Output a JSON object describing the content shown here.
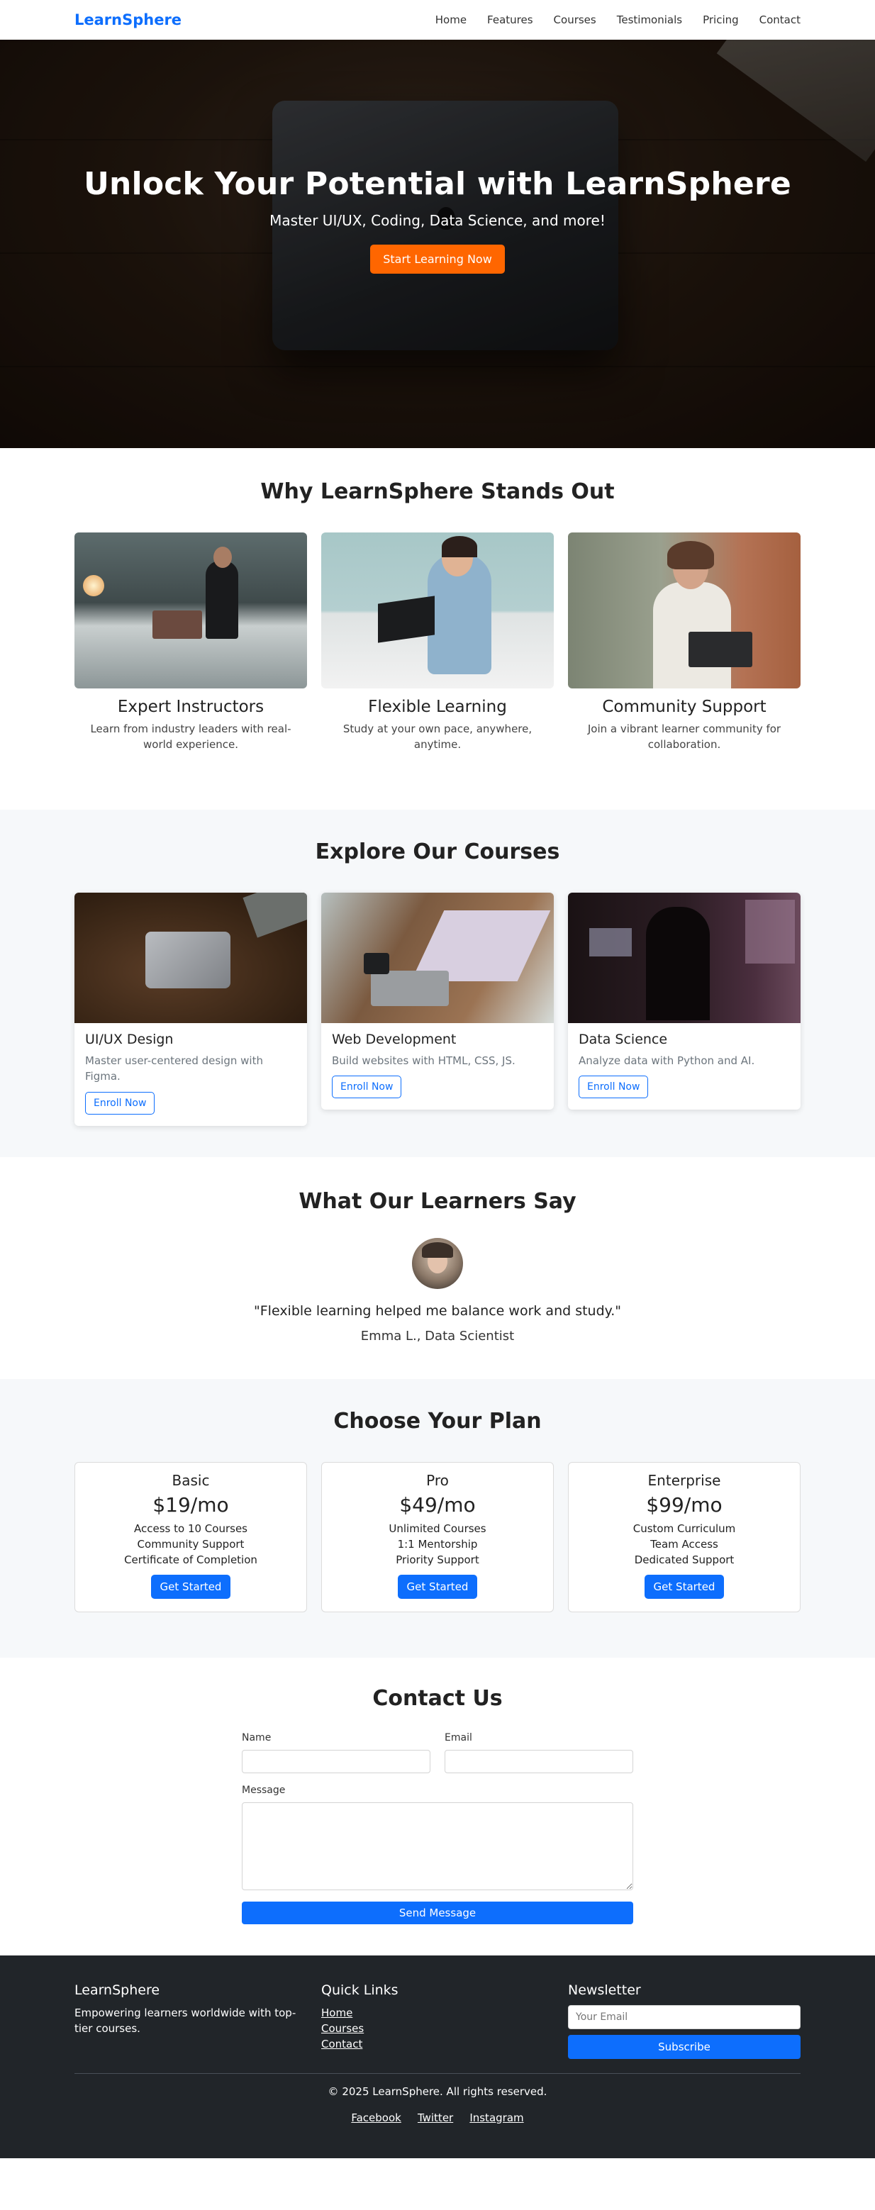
{
  "nav": {
    "brand": "LearnSphere",
    "links": [
      "Home",
      "Features",
      "Courses",
      "Testimonials",
      "Pricing",
      "Contact"
    ]
  },
  "hero": {
    "title": "Unlock Your Potential with LearnSphere",
    "subtitle": "Master UI/UX, Coding, Data Science, and more!",
    "cta": "Start Learning Now"
  },
  "features": {
    "title": "Why LearnSphere Stands Out",
    "items": [
      {
        "title": "Expert Instructors",
        "text": "Learn from industry leaders with real-world experience."
      },
      {
        "title": "Flexible Learning",
        "text": "Study at your own pace, anywhere, anytime."
      },
      {
        "title": "Community Support",
        "text": "Join a vibrant learner community for collaboration."
      }
    ]
  },
  "courses": {
    "title": "Explore Our Courses",
    "items": [
      {
        "title": "UI/UX Design",
        "text": "Master user-centered design with Figma.",
        "button": "Enroll Now"
      },
      {
        "title": "Web Development",
        "text": "Build websites with HTML, CSS, JS.",
        "button": "Enroll Now"
      },
      {
        "title": "Data Science",
        "text": "Analyze data with Python and AI.",
        "button": "Enroll Now"
      }
    ]
  },
  "testimonials": {
    "title": "What Our Learners Say",
    "quote": "\"Flexible learning helped me balance work and study.\"",
    "author": "Emma L., Data Scientist"
  },
  "pricing": {
    "title": "Choose Your Plan",
    "plans": [
      {
        "name": "Basic",
        "price": "$19/mo",
        "features": [
          "Access to 10 Courses",
          "Community Support",
          "Certificate of Completion"
        ],
        "button": "Get Started"
      },
      {
        "name": "Pro",
        "price": "$49/mo",
        "features": [
          "Unlimited Courses",
          "1:1 Mentorship",
          "Priority Support"
        ],
        "button": "Get Started"
      },
      {
        "name": "Enterprise",
        "price": "$99/mo",
        "features": [
          "Custom Curriculum",
          "Team Access",
          "Dedicated Support"
        ],
        "button": "Get Started"
      }
    ]
  },
  "contact": {
    "title": "Contact Us",
    "name_label": "Name",
    "email_label": "Email",
    "message_label": "Message",
    "submit": "Send Message"
  },
  "footer": {
    "brand": "LearnSphere",
    "tagline": "Empowering learners worldwide with top-tier courses.",
    "quick_links_title": "Quick Links",
    "quick_links": [
      "Home",
      "Courses",
      "Contact"
    ],
    "newsletter_title": "Newsletter",
    "newsletter_placeholder": "Your Email",
    "subscribe": "Subscribe",
    "copyright": "© 2025 LearnSphere. All rights reserved.",
    "socials": [
      "Facebook",
      "Twitter",
      "Instagram"
    ]
  },
  "colors": {
    "primary": "#0d6efd",
    "accent": "#ff6600",
    "footer_bg": "#212529"
  }
}
